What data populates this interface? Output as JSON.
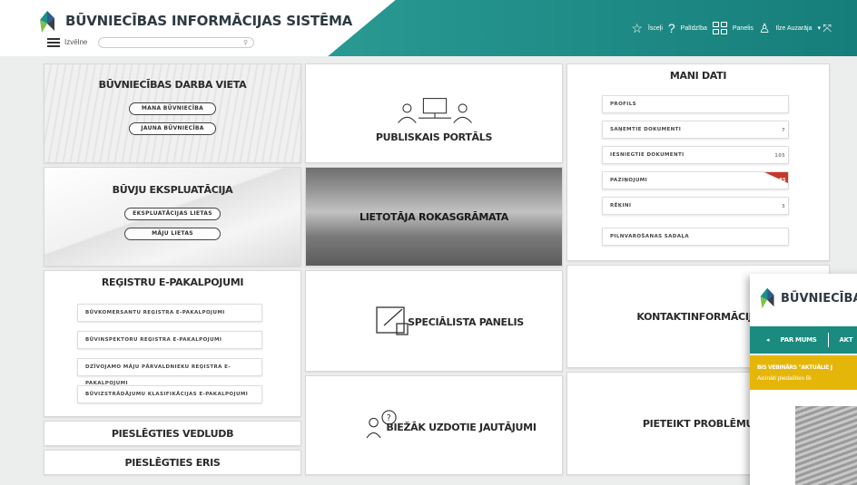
{
  "header": {
    "title": "BŪVNIECĪBAS INFORMĀCIJAS SISTĒMA",
    "menu_label": "Izvēlne",
    "nav": {
      "isceli": "Īsceļi",
      "palidziba": "Palīdzība",
      "panelis": "Panelis",
      "user": "Ilze Auzarāja"
    },
    "colors": {
      "teal": "#1f8f88"
    }
  },
  "tiles": {
    "darba_vieta": {
      "title": "BŪVNIECĪBAS DARBA VIETA",
      "buttons": [
        "MANA BŪVNIECĪBA",
        "JAUNA BŪVNIECĪBA"
      ]
    },
    "publiskais": {
      "title": "PUBLISKAIS PORTĀLS"
    },
    "mani_dati": {
      "title": "MANI DATI",
      "items": [
        {
          "label": "PROFILS",
          "badge": ""
        },
        {
          "label": "SAŅEMTIE DOKUMENTI",
          "badge": "7"
        },
        {
          "label": "IESNIEGTIE DOKUMENTI",
          "badge": "105"
        },
        {
          "label": "PAZIŅOJUMI",
          "badge": "85"
        },
        {
          "label": "RĒĶINI",
          "badge": "3"
        },
        {
          "label": "PILNVAROŠANAS SADAĻA",
          "badge": ""
        }
      ]
    },
    "ekspluatacija": {
      "title": "BŪVJU EKSPLUATĀCIJA",
      "buttons": [
        "EKSPLUATĀCIJAS LIETAS",
        "MĀJU LIETAS"
      ]
    },
    "rokasgramata": {
      "title": "LIETOTĀJA ROKASGRĀMATA"
    },
    "registru": {
      "title": "REĢISTRU E-PAKALPOJUMI",
      "items": [
        "BŪVKOMERSANTU REĢISTRA E-PAKALPOJUMI",
        "BŪVINSPEKTORU REĢISTRA E-PAKALPOJUMI",
        "DZĪVOJAMO MĀJU PĀRVALDNIEKU REĢISTRA E-PAKALPOJUMI",
        "BŪVIZSTRĀDĀJUMU KLASIFIKĀCIJAS E-PAKALPOJUMI"
      ]
    },
    "specialista": {
      "title": "SPECIĀLISTA PANELIS"
    },
    "kontakt": {
      "title": "KONTAKTINFORMĀCIJA"
    },
    "vedludb": {
      "title": "PIESLĒGTIES VEDLUDB"
    },
    "eris": {
      "title": "PIESLĒGTIES ERIS"
    },
    "biezak": {
      "title": "BIEŽĀK UZDOTIE JAUTĀJUMI"
    },
    "problemu": {
      "title": "PIETEIKT PROBLĒMU"
    }
  },
  "popup": {
    "title": "BŪVNIECĪBAS I",
    "nav": [
      "PAR MUMS",
      "AKT"
    ],
    "banner_line1": "BIS VEBINĀRS \"AKTUĀLIE J",
    "banner_line2": "Aicināti piedalīties Bi"
  }
}
